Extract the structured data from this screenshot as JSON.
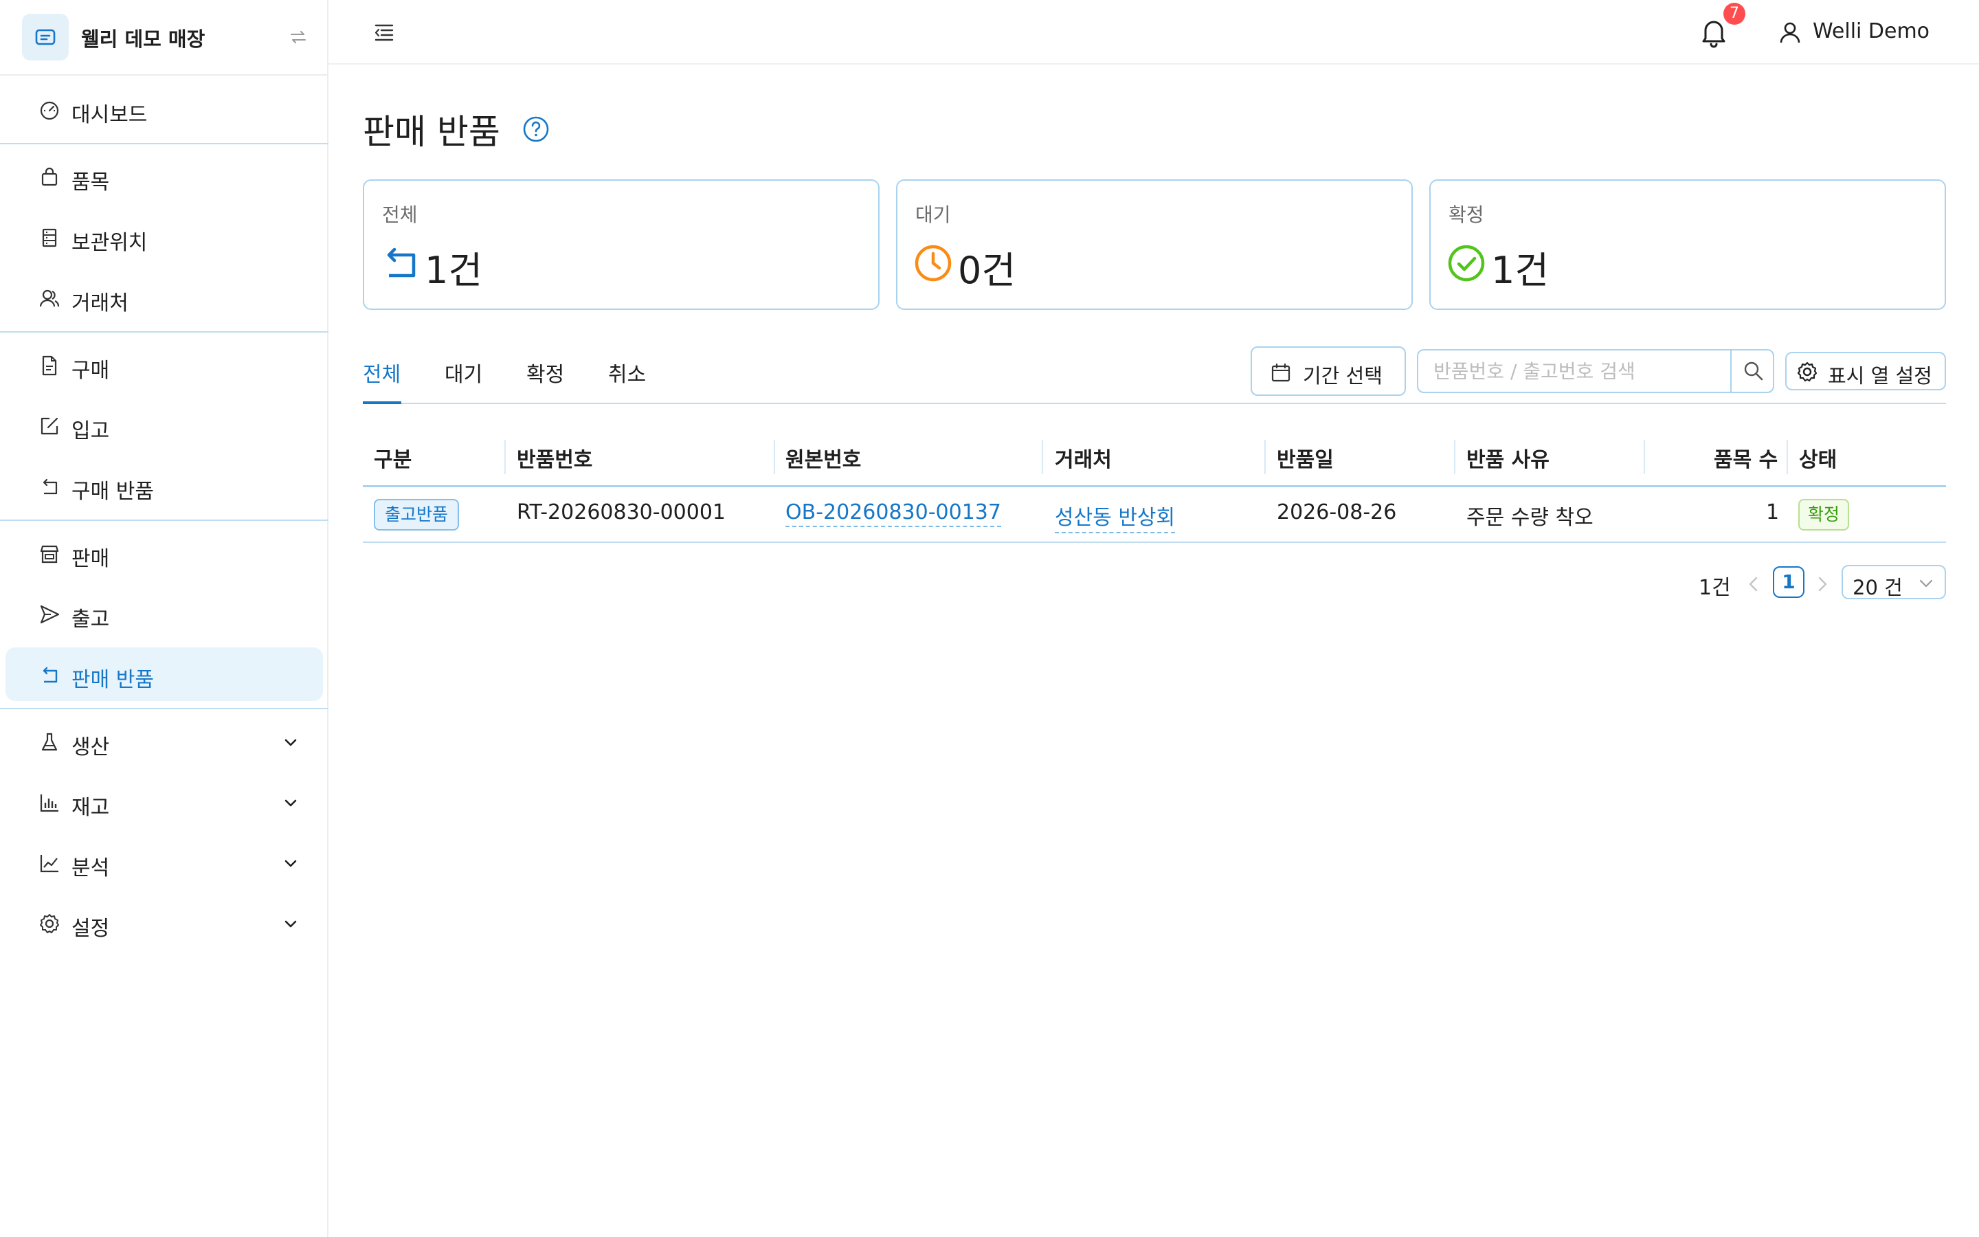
{
  "brand": {
    "name": "웰리 데모 매장"
  },
  "sidebar": {
    "items": [
      {
        "label": "대시보드",
        "icon": "dashboard-gauge-icon"
      },
      {
        "label": "품목",
        "icon": "shopping-bag-icon"
      },
      {
        "label": "보관위치",
        "icon": "storage-rack-icon"
      },
      {
        "label": "거래처",
        "icon": "users-icon"
      },
      {
        "label": "구매",
        "icon": "document-icon"
      },
      {
        "label": "입고",
        "icon": "edit-box-icon"
      },
      {
        "label": "구매 반품",
        "icon": "return-arrow-icon"
      },
      {
        "label": "판매",
        "icon": "store-icon"
      },
      {
        "label": "출고",
        "icon": "send-icon"
      },
      {
        "label": "판매 반품",
        "icon": "return-arrow-icon",
        "active": true
      },
      {
        "label": "생산",
        "icon": "flask-icon",
        "expandable": true
      },
      {
        "label": "재고",
        "icon": "bar-chart-icon",
        "expandable": true
      },
      {
        "label": "분석",
        "icon": "line-chart-icon",
        "expandable": true
      },
      {
        "label": "설정",
        "icon": "gear-icon",
        "expandable": true
      }
    ]
  },
  "header": {
    "notification_count": "7",
    "user_name": "Welli Demo"
  },
  "page": {
    "title": "판매 반품"
  },
  "stats": [
    {
      "label": "전체",
      "value": "1건",
      "icon": "return-arrow-icon",
      "color": "#1677c8"
    },
    {
      "label": "대기",
      "value": "0건",
      "icon": "clock-icon",
      "color": "#fa8c16"
    },
    {
      "label": "확정",
      "value": "1건",
      "icon": "check-circle-icon",
      "color": "#52c41a"
    }
  ],
  "tabs": [
    "전체",
    "대기",
    "확정",
    "취소"
  ],
  "active_tab": "전체",
  "toolbar": {
    "date_label": "기간 선택",
    "search_placeholder": "반품번호 / 출고번호 검색",
    "columns_label": "표시 열 설정"
  },
  "table": {
    "columns": [
      "구분",
      "반품번호",
      "원본번호",
      "거래처",
      "반품일",
      "반품 사유",
      "품목 수",
      "상태"
    ],
    "rows": [
      {
        "type": "출고반품",
        "return_no": "RT-20260830-00001",
        "origin_no": "OB-20260830-00137",
        "partner": "성산동 반상회",
        "date": "2026-08-26",
        "reason": "주문 수량 착오",
        "item_count": "1",
        "status": "확정"
      }
    ]
  },
  "pagination": {
    "total": "1건",
    "current_page": "1",
    "page_size": "20 건"
  },
  "colors": {
    "accent": "#1677c8",
    "border": "#a9d3ee",
    "badge": "#ff4d4f",
    "success": "#52c41a",
    "warning": "#fa8c16"
  }
}
